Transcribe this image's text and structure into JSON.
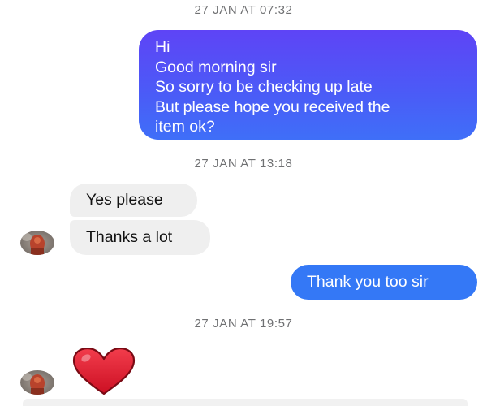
{
  "conversation": {
    "timestamps": [
      "27 JAN AT 07:32",
      "27 JAN AT 13:18",
      "27 JAN AT 19:57"
    ],
    "message_1": {
      "direction": "outgoing",
      "lines": [
        "Hi",
        "Good morning sir",
        "So sorry to be checking up late",
        "But please hope you received the",
        "item ok?"
      ]
    },
    "message_2": {
      "direction": "incoming",
      "text": "Yes please"
    },
    "message_3": {
      "direction": "incoming",
      "text": "Thanks a lot"
    },
    "message_4": {
      "direction": "outgoing",
      "text": "Thank you too sir"
    },
    "message_5": {
      "direction": "incoming",
      "content": "heart-emoji"
    }
  },
  "colors": {
    "outgoing_gradient_start": "#5e44f6",
    "outgoing_gradient_end": "#3f6ff8",
    "outgoing_solid": "#3478f6",
    "incoming_bubble": "#efefef",
    "timestamp_text": "#6f7072",
    "heart": "#e3152e"
  },
  "icons": {
    "avatar": "contact-avatar",
    "reaction": "heart-emoji"
  }
}
